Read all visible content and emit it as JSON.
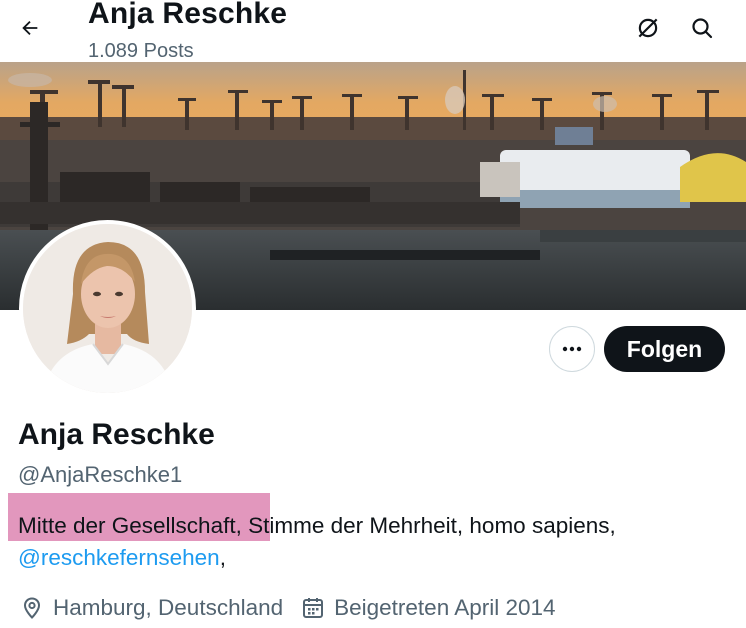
{
  "header": {
    "title": "Anja Reschke",
    "posts_count": "1.089 Posts",
    "icons": [
      "back-arrow-icon",
      "grok-icon",
      "search-icon"
    ]
  },
  "profile": {
    "display_name": "Anja Reschke",
    "handle": "@AnjaReschke1",
    "more_label": "···",
    "follow_label": "Folgen",
    "bio": {
      "highlighted_text": "Mitte der Gesellschaft",
      "rest_text": ", Stimme der Mehrheit, homo sapiens,",
      "mention": "@reschkefernsehen",
      "trailing": ","
    },
    "location": "Hamburg, Deutschland",
    "joined": "Beigetreten April 2014"
  },
  "colors": {
    "text": "#0f1419",
    "secondary": "#536471",
    "link": "#1d9bf0",
    "highlight": "#dd85b2"
  }
}
